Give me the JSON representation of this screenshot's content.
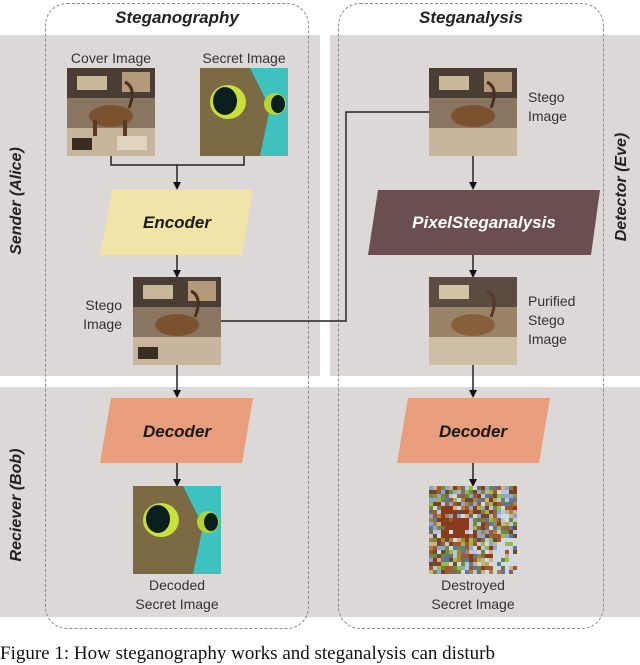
{
  "columns": {
    "steganography": {
      "title": "Steganography"
    },
    "steganalysis": {
      "title": "Steganalysis"
    }
  },
  "roles": {
    "sender": "Sender (Alice)",
    "receiver": "Reciever (Bob)",
    "detector": "Detector (Eve)"
  },
  "labels": {
    "cover_image": "Cover Image",
    "secret_image": "Secret Image",
    "stego_line1": "Stego",
    "stego_line2": "Image",
    "purified_line1": "Purified",
    "purified_line2": "Stego",
    "purified_line3": "Image",
    "decoded_line1": "Decoded",
    "decoded_line2": "Secret Image",
    "destroyed_line1": "Destroyed",
    "destroyed_line2": "Secret Image"
  },
  "blocks": {
    "encoder": {
      "label": "Encoder",
      "color": "#f0e4a8",
      "text_color": "#1a1a1a"
    },
    "pixelsteganalysis": {
      "label": "PixelSteganalysis",
      "color": "#6b4f50",
      "text_color": "#ffffff"
    },
    "decoder_left": {
      "label": "Decoder",
      "color": "#e89e7c",
      "text_color": "#1a1a1a"
    },
    "decoder_right": {
      "label": "Decoder",
      "color": "#e89e7c",
      "text_color": "#1a1a1a"
    }
  },
  "caption": "Figure 1: How steganography works and steganalysis can disturb"
}
